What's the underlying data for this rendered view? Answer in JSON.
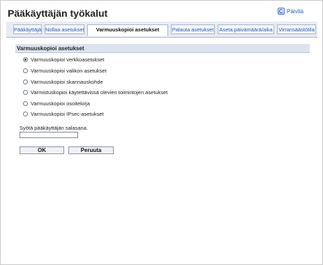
{
  "header": {
    "title": "Pääkäyttäjän työkalut",
    "refresh_label": "Päivitä"
  },
  "tabs": [
    {
      "label": "Pääkäyttäjä",
      "active": false
    },
    {
      "label": "Nollaa asetukset",
      "active": false
    },
    {
      "label": "Varmuuskopioi asetukset",
      "active": true
    },
    {
      "label": "Palauta asetukset",
      "active": false
    },
    {
      "label": "Aseta päivämäärä/aika",
      "active": false
    },
    {
      "label": "Virransäästötila",
      "active": false
    }
  ],
  "section": {
    "title": "Varmuuskopioi asetukset",
    "options": [
      {
        "label": "Varmuuskopioi verkkoasetukset",
        "checked": true
      },
      {
        "label": "Varmuuskopioi valikon asetukset",
        "checked": false
      },
      {
        "label": "Varmuuskopioi skannauskohde",
        "checked": false
      },
      {
        "label": "Varmistuskopioi käytettävissä olevien toimintojen asetukset",
        "checked": false
      },
      {
        "label": "Varmuuskopioi osoitekirja",
        "checked": false
      },
      {
        "label": "Varmuuskopioi IPsec-asetukset",
        "checked": false
      }
    ]
  },
  "password": {
    "label": "Syötä pääkäyttäjän salasana.",
    "value": ""
  },
  "buttons": {
    "ok": "OK",
    "cancel": "Peruuta"
  },
  "colors": {
    "link": "#2c5cb0",
    "tab_bar": "#e7ecf4",
    "section_header": "#dde4ef"
  }
}
